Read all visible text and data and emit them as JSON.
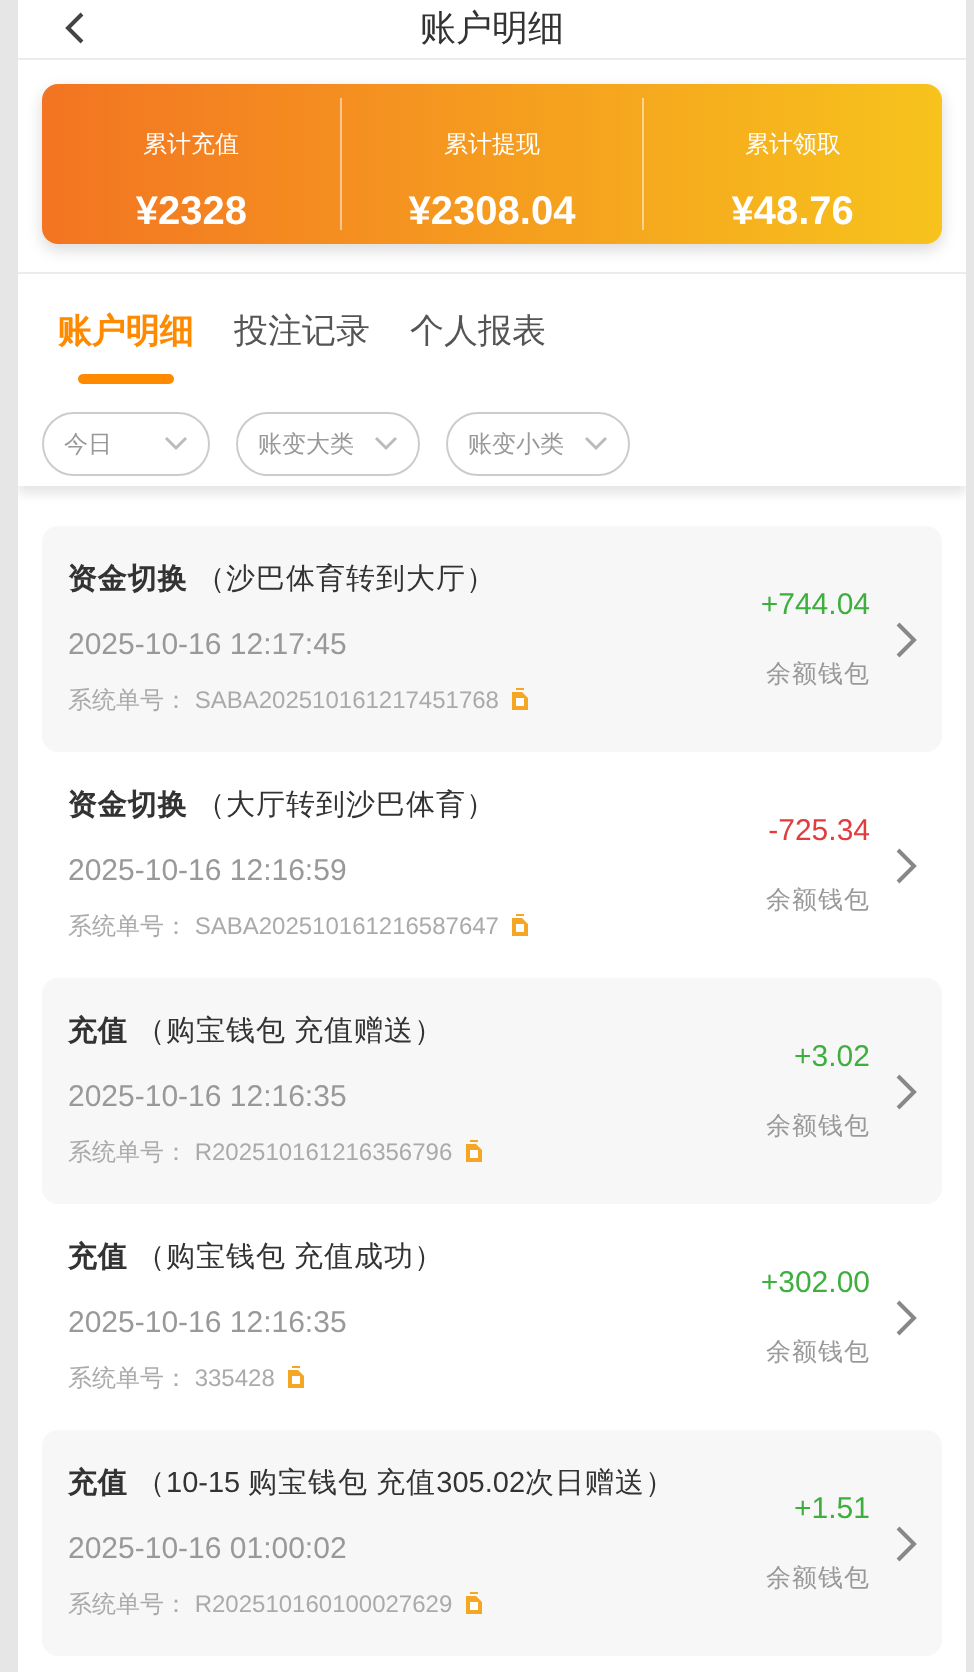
{
  "header": {
    "title": "账户明细"
  },
  "summary": [
    {
      "label": "累计充值",
      "value": "¥2328"
    },
    {
      "label": "累计提现",
      "value": "¥2308.04"
    },
    {
      "label": "累计领取",
      "value": "¥48.76"
    }
  ],
  "tabs": [
    {
      "label": "账户明细",
      "selected": true
    },
    {
      "label": "投注记录",
      "selected": false
    },
    {
      "label": "个人报表",
      "selected": false
    }
  ],
  "filters": [
    {
      "label": "今日"
    },
    {
      "label": "账变大类"
    },
    {
      "label": "账变小类"
    }
  ],
  "records": [
    {
      "type": "资金切换",
      "detail": "（沙巴体育转到大厅）",
      "time": "2025-10-16 12:17:45",
      "order_label": "系统单号：",
      "order_no": "SABA202510161217451768",
      "amount": "+744.04",
      "color": "#3eae3e",
      "wallet": "余额钱包"
    },
    {
      "type": "资金切换",
      "detail": "（大厅转到沙巴体育）",
      "time": "2025-10-16 12:16:59",
      "order_label": "系统单号：",
      "order_no": "SABA202510161216587647",
      "amount": "-725.34",
      "color": "#e23c3c",
      "wallet": "余额钱包"
    },
    {
      "type": "充值",
      "detail": "（购宝钱包 充值赠送）",
      "time": "2025-10-16 12:16:35",
      "order_label": "系统单号：",
      "order_no": "R202510161216356796",
      "amount": "+3.02",
      "color": "#3eae3e",
      "wallet": "余额钱包"
    },
    {
      "type": "充值",
      "detail": "（购宝钱包 充值成功）",
      "time": "2025-10-16 12:16:35",
      "order_label": "系统单号：",
      "order_no": "335428",
      "amount": "+302.00",
      "color": "#3eae3e",
      "wallet": "余额钱包"
    },
    {
      "type": "充值",
      "detail": "（10-15 购宝钱包 充值305.02次日赠送）",
      "time": "2025-10-16 01:00:02",
      "order_label": "系统单号：",
      "order_no": "R202510160100027629",
      "amount": "+1.51",
      "color": "#3eae3e",
      "wallet": "余额钱包"
    }
  ]
}
